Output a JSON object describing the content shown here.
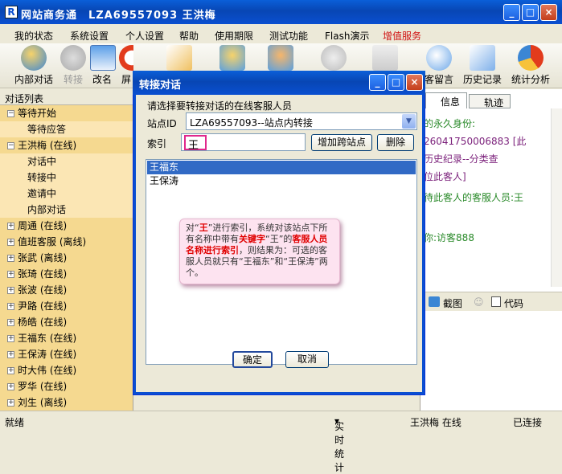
{
  "window": {
    "title": "网站商务通　LZA69557093 王洪梅",
    "icon": "R",
    "min": "_",
    "max": "□",
    "close": "×"
  },
  "menu": [
    "我的状态",
    "系统设置",
    "个人设置",
    "帮助",
    "使用期限",
    "测试功能",
    "Flash演示",
    "增值服务"
  ],
  "toolbar": [
    {
      "label": "内部对话",
      "icon": "chat-people-icon",
      "disabled": false
    },
    {
      "label": "转接",
      "icon": "transfer-icon",
      "disabled": true
    },
    {
      "label": "改名",
      "icon": "rename-card-icon",
      "disabled": false
    },
    {
      "label": "屏",
      "icon": "block-icon",
      "disabled": false
    },
    {
      "label": "",
      "icon": "edit-icon",
      "disabled": false
    },
    {
      "label": "",
      "icon": "visitor-icon",
      "disabled": false
    },
    {
      "label": "",
      "icon": "visitors-icon",
      "disabled": false
    },
    {
      "label": "",
      "icon": "globe-icon",
      "disabled": true
    },
    {
      "label": "",
      "icon": "forward-icon",
      "disabled": true
    },
    {
      "label": "客留言",
      "icon": "message-bubble-icon",
      "disabled": false
    },
    {
      "label": "历史记录",
      "icon": "history-icon",
      "disabled": false
    },
    {
      "label": "统计分析",
      "icon": "stats-pie-icon",
      "disabled": false
    }
  ],
  "left_panel": {
    "header": "对话列表",
    "nodes": [
      {
        "label": "等待开始",
        "indent": 0,
        "expander": "−"
      },
      {
        "label": "等待应答",
        "indent": 1,
        "expander": ""
      },
      {
        "label": "王洪梅 (在线)",
        "indent": 0,
        "expander": "−"
      },
      {
        "label": "对话中",
        "indent": 1,
        "expander": ""
      },
      {
        "label": "转接中",
        "indent": 1,
        "expander": ""
      },
      {
        "label": "邀请中",
        "indent": 1,
        "expander": ""
      },
      {
        "label": "内部对话",
        "indent": 1,
        "expander": ""
      },
      {
        "label": "周通 (在线)",
        "indent": 0,
        "expander": "+"
      },
      {
        "label": "值班客服 (离线)",
        "indent": 0,
        "expander": "+"
      },
      {
        "label": "张武 (离线)",
        "indent": 0,
        "expander": "+"
      },
      {
        "label": "张琦 (在线)",
        "indent": 0,
        "expander": "+"
      },
      {
        "label": "张波 (在线)",
        "indent": 0,
        "expander": "+"
      },
      {
        "label": "尹路 (在线)",
        "indent": 0,
        "expander": "+"
      },
      {
        "label": "杨皓 (在线)",
        "indent": 0,
        "expander": "+"
      },
      {
        "label": "王福东 (在线)",
        "indent": 0,
        "expander": "+"
      },
      {
        "label": "王保涛 (在线)",
        "indent": 0,
        "expander": "+"
      },
      {
        "label": "时大伟 (在线)",
        "indent": 0,
        "expander": "+"
      },
      {
        "label": "罗华 (在线)",
        "indent": 0,
        "expander": "+"
      },
      {
        "label": "刘生 (离线)",
        "indent": 0,
        "expander": "+"
      }
    ]
  },
  "right_panel": {
    "tabs": [
      "信息",
      "轨迹"
    ],
    "lines": [
      {
        "text": "的永久身份:",
        "color": "#2a8a2a"
      },
      {
        "text": "26041750006883 [此",
        "color": "#7a1f7a"
      },
      {
        "text": "历史纪录--分类查",
        "color": "#7a1f7a"
      },
      {
        "text": "位此客人]",
        "color": "#7a1f7a"
      },
      {
        "text": "待此客人的客服人员:王",
        "color": "#2a8a2a"
      },
      {
        "text": "你:访客888",
        "color": "#2a8a2a"
      }
    ],
    "tools": [
      "截图",
      "代码"
    ]
  },
  "dialog": {
    "title": "转接对话",
    "prompt": "请选择要转接对话的在线客服人员",
    "site_label": "站点ID",
    "site_value": "LZA69557093--站点内转接",
    "index_label": "索引",
    "index_value": "王",
    "add_site_button": "增加跨站点",
    "delete_button": "删除",
    "list": [
      {
        "name": "王福东",
        "selected": true
      },
      {
        "name": "王保涛",
        "selected": false
      }
    ],
    "note": [
      {
        "t": "对“",
        "r": false
      },
      {
        "t": "王",
        "r": true
      },
      {
        "t": "”进行索引，系统对该站点下所有名称中带有",
        "r": false
      },
      {
        "t": "关键字",
        "r": true
      },
      {
        "t": "“王”的",
        "r": false
      },
      {
        "t": "客服人员名称进行索引",
        "r": true
      },
      {
        "t": "，则结果为：可选的客服人员就只有“王福东”和“王保涛”两个。",
        "r": false
      }
    ],
    "ok_button": "确定",
    "cancel_button": "取消"
  },
  "statusbar": {
    "left": "就绪",
    "stats": "实时统计",
    "user": "王洪梅 在线",
    "conn": "已连接"
  }
}
